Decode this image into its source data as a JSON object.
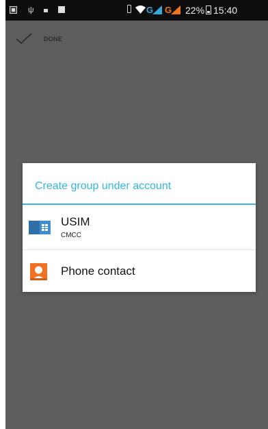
{
  "status_bar": {
    "network_1": "G",
    "network_2": "G",
    "battery": "22%",
    "time": "15:40",
    "icons": [
      "notification-icon",
      "usb-icon",
      "dot-icon",
      "square-icon",
      "vibrate-icon",
      "wifi-icon",
      "signal-icon",
      "signal-icon",
      "battery-icon"
    ]
  },
  "action_bar": {
    "done_label": "DONE",
    "done_icon": "checkmark-icon"
  },
  "dialog": {
    "title": "Create group under account",
    "options": [
      {
        "label": "USIM",
        "sublabel": "CMCC",
        "icon": "sim-card-icon"
      },
      {
        "label": "Phone contact",
        "icon": "phone-contact-icon"
      }
    ]
  },
  "colors": {
    "accent": "#33b5e5",
    "dim_overlay": "#5d5d5d",
    "status_bar": "#0d0d0d",
    "network_1": "#35a7d8",
    "network_2": "#f0741d",
    "contact_icon": "#f17022"
  }
}
